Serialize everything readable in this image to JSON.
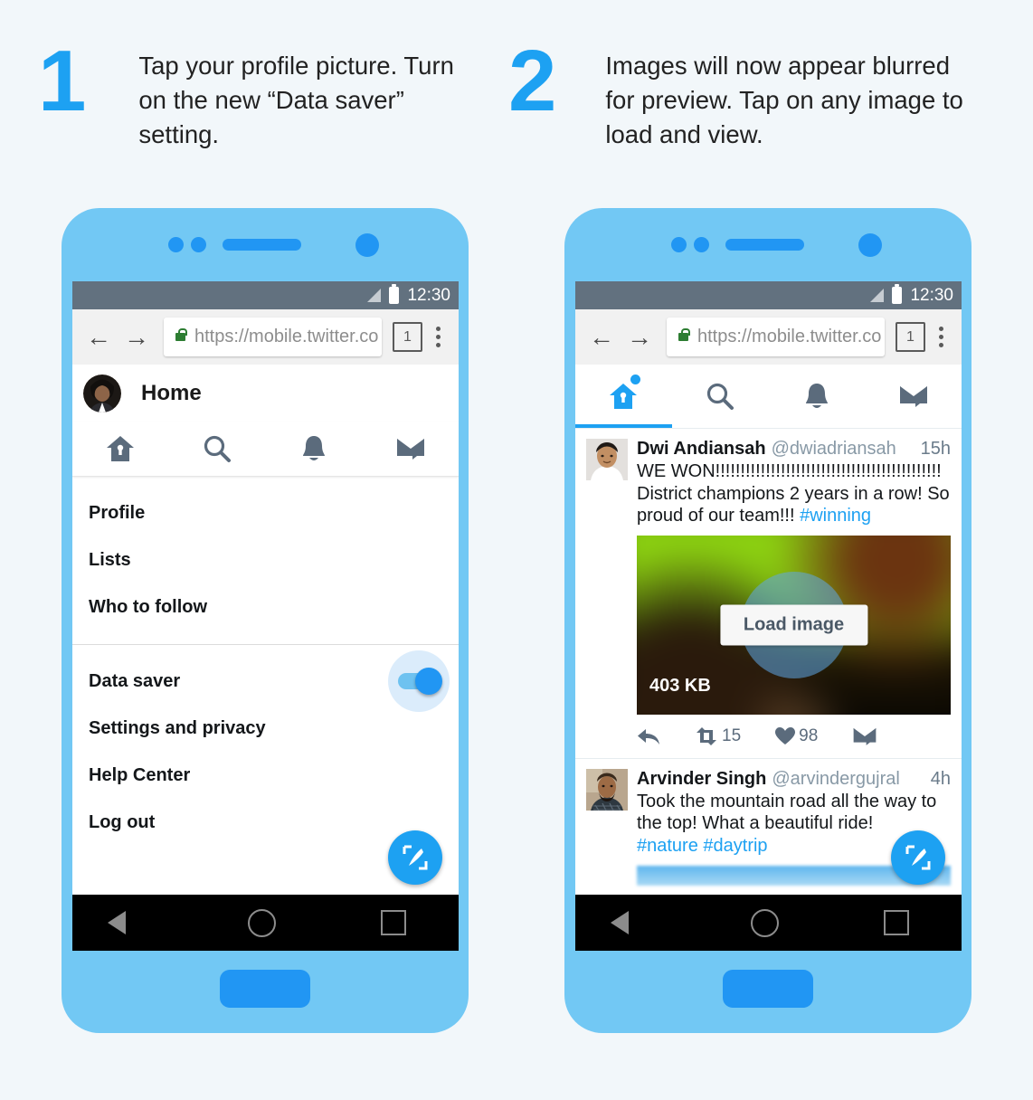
{
  "page": {
    "background_color": "#f2f7fa",
    "accent_color": "#1da1f2"
  },
  "steps": [
    {
      "number": "1",
      "text": "Tap your profile picture. Turn on the new “Data saver” setting."
    },
    {
      "number": "2",
      "text": "Images will now appear blurred for preview. Tap on any image to load and view."
    }
  ],
  "phone1": {
    "status_bar": {
      "time": "12:30",
      "signal_icon": "signal-bars-icon",
      "battery_icon": "battery-icon"
    },
    "browser": {
      "back_icon": "←",
      "forward_icon": "→",
      "lock_icon": "lock-icon",
      "url": "https://mobile.twitter.co",
      "tab_count": "1",
      "menu_icon": "kebab-menu-icon"
    },
    "header": {
      "title": "Home",
      "avatar": "profile-avatar"
    },
    "tabs": [
      {
        "name": "home-tab",
        "icon": "home-icon",
        "active": false
      },
      {
        "name": "search-tab",
        "icon": "search-icon",
        "active": false
      },
      {
        "name": "notifications-tab",
        "icon": "bell-icon",
        "active": false
      },
      {
        "name": "messages-tab",
        "icon": "envelope-icon",
        "active": false
      }
    ],
    "menu_group_1": [
      {
        "label": "Profile"
      },
      {
        "label": "Lists"
      },
      {
        "label": "Who to follow"
      }
    ],
    "menu_group_2": [
      {
        "label": "Data saver",
        "toggle": true,
        "toggle_state": "on"
      },
      {
        "label": "Settings and privacy",
        "toggle": false
      },
      {
        "label": "Help Center",
        "toggle": false
      },
      {
        "label": "Log out",
        "toggle": false
      }
    ],
    "fab": {
      "icon": "compose-icon"
    },
    "android_nav": {
      "back": "back-triangle-icon",
      "home": "home-circle-icon",
      "recents": "recents-square-icon"
    }
  },
  "phone2": {
    "status_bar": {
      "time": "12:30",
      "signal_icon": "signal-bars-icon",
      "battery_icon": "battery-icon"
    },
    "browser": {
      "back_icon": "←",
      "forward_icon": "→",
      "lock_icon": "lock-icon",
      "url": "https://mobile.twitter.co",
      "tab_count": "1",
      "menu_icon": "kebab-menu-icon"
    },
    "tabs": [
      {
        "name": "home-tab",
        "icon": "home-icon",
        "active": true,
        "has_notification_dot": true
      },
      {
        "name": "search-tab",
        "icon": "search-icon",
        "active": false
      },
      {
        "name": "notifications-tab",
        "icon": "bell-icon",
        "active": false
      },
      {
        "name": "messages-tab",
        "icon": "envelope-icon",
        "active": false
      }
    ],
    "tweets": [
      {
        "name": "Dwi Andiansah",
        "handle": "@dwiadriansah",
        "time": "15h",
        "text_line1": "WE WON!!!!!!!!!!!!!!!!!!!!!!!!!!!!!!!!!!!!!!!!!!!!!",
        "text_line2": "District champions 2 years in a row! So proud of our team!!! ",
        "hashtag": "#winning",
        "media": {
          "load_button_label": "Load image",
          "size_label": "403 KB",
          "state": "blurred-preview"
        },
        "actions": {
          "reply_icon": "reply-icon",
          "retweet_icon": "retweet-icon",
          "retweet_count": "15",
          "like_icon": "heart-icon",
          "like_count": "98",
          "message_icon": "envelope-icon"
        }
      },
      {
        "name": "Arvinder Singh",
        "handle": "@arvindergujral",
        "time": "4h",
        "text_line1": "Took the mountain road all the way to the top! What a beautiful ride!",
        "hashtag": "#nature #daytrip",
        "media": {
          "state": "blurred-preview-partial"
        }
      }
    ],
    "fab": {
      "icon": "compose-icon"
    },
    "android_nav": {
      "back": "back-triangle-icon",
      "home": "home-circle-icon",
      "recents": "recents-square-icon"
    }
  }
}
